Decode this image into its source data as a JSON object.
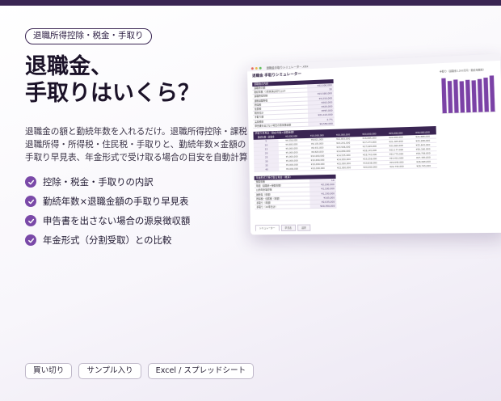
{
  "badge": "退職所得控除・税金・手取り",
  "headline": {
    "line1": "退職金、",
    "line2": "手取りはいくら？"
  },
  "description": "退職金の額と勤続年数を入れるだけ。退職所得控除・課税退職所得・所得税・住民税・手取りと、勤続年数×金額の手取り早見表、年金形式で受け取る場合の目安を自動計算",
  "features": [
    "控除・税金・手取りの内訳",
    "勤続年数×退職金額の手取り早見表",
    "申告書を出さない場合の源泉徴収額",
    "年金形式（分割受取）との比較"
  ],
  "tags": [
    "買い切り",
    "サンプル入り",
    "Excel / スプレッドシート"
  ],
  "colors": {
    "accent": "#3a2553",
    "check": "#7a49a8",
    "bar": "#7b42a6"
  },
  "mockup": {
    "file_name": "退職金手取りシミュレーター.xlsx",
    "sheet_title": "退職金 手取りシミュレーター",
    "input_title": "退職金の内訳",
    "input_rows": [
      {
        "label": "退職金の額",
        "value": "¥22,000,000"
      },
      {
        "label": "勤続年数（1年未満は切り上げ）",
        "value": "30"
      },
      {
        "label": "退職所得控除",
        "value": "¥15,500,000"
      },
      {
        "label": "課税退職所得",
        "value": "¥3,250,000"
      },
      {
        "label": "所得税",
        "value": "¥262,000"
      },
      {
        "label": "住民税",
        "value": "¥325,000"
      },
      {
        "label": "税金合計",
        "value": "¥587,000"
      },
      {
        "label": "手取り額",
        "value": "¥21,413,000"
      },
      {
        "label": "実質税率",
        "value": "2.7%"
      },
      {
        "label": "申告書を出さない場合の源泉徴収額",
        "value": "¥4,550,000"
      }
    ],
    "grid_title": "手取り早見表（勤続年数×退職金額）",
    "grid_header": [
      "勤続年数 / 退職金",
      "¥5,000,000",
      "¥10,000,000",
      "¥15,000,000",
      "¥20,000,000",
      "¥25,000,000",
      "¥30,000,000"
    ],
    "grid_rows": [
      [
        "5",
        "¥4,558,000",
        "¥8,821,000",
        "¥12,853,000",
        "¥16,885,000",
        "¥20,906,000",
        "¥24,888,000"
      ],
      [
        "10",
        "¥4,800,000",
        "¥9,135,000",
        "¥13,241,000",
        "¥17,273,000",
        "¥21,305,000",
        "¥25,288,000"
      ],
      [
        "15",
        "¥5,000,000",
        "¥9,431,000",
        "¥13,596,000",
        "¥17,628,000",
        "¥21,660,000",
        "¥25,643,000"
      ],
      [
        "20",
        "¥5,000,000",
        "¥9,820,000",
        "¥14,080,000",
        "¥18,145,000",
        "¥22,177,000",
        "¥26,160,000"
      ],
      [
        "25",
        "¥5,000,000",
        "¥10,000,000",
        "¥14,535,000",
        "¥18,743,000",
        "¥22,775,000",
        "¥26,758,000"
      ],
      [
        "30",
        "¥5,000,000",
        "¥10,000,000",
        "¥14,950,000",
        "¥19,356,000",
        "¥23,413,000",
        "¥27,395,000"
      ],
      [
        "35",
        "¥5,000,000",
        "¥10,000,000",
        "¥15,000,000",
        "¥19,838,000",
        "¥24,045,000",
        "¥28,068,000"
      ],
      [
        "40",
        "¥5,000,000",
        "¥10,000,000",
        "¥15,000,000",
        "¥20,000,000",
        "¥24,730,000",
        "¥28,745,000"
      ]
    ],
    "pension_title": "年金形式で受け取る場合（概算）",
    "pension_rows": [
      {
        "label": "受取年数",
        "value": "10"
      },
      {
        "label": "年額（退職金÷受取年数）",
        "value": "¥2,200,000"
      },
      {
        "label": "公的年金等控除",
        "value": "¥1,100,000"
      },
      {
        "label": "雑所得（年額）",
        "value": "¥1,100,000"
      },
      {
        "label": "所得税・住民税（年額）",
        "value": "¥165,000"
      },
      {
        "label": "手取り（年額）",
        "value": "¥2,035,000"
      },
      {
        "label": "手取り（10年合計）",
        "value": "¥20,350,000"
      }
    ],
    "chart": {
      "title": "手取り（退職金2,200万円・勤続年数別）",
      "values": [
        0.95,
        0.87,
        0.9,
        0.85,
        0.88,
        0.86,
        0.89,
        0.92,
        0.97
      ]
    },
    "sheet_tabs": [
      "シミュレーター",
      "早見表",
      "設定"
    ]
  }
}
